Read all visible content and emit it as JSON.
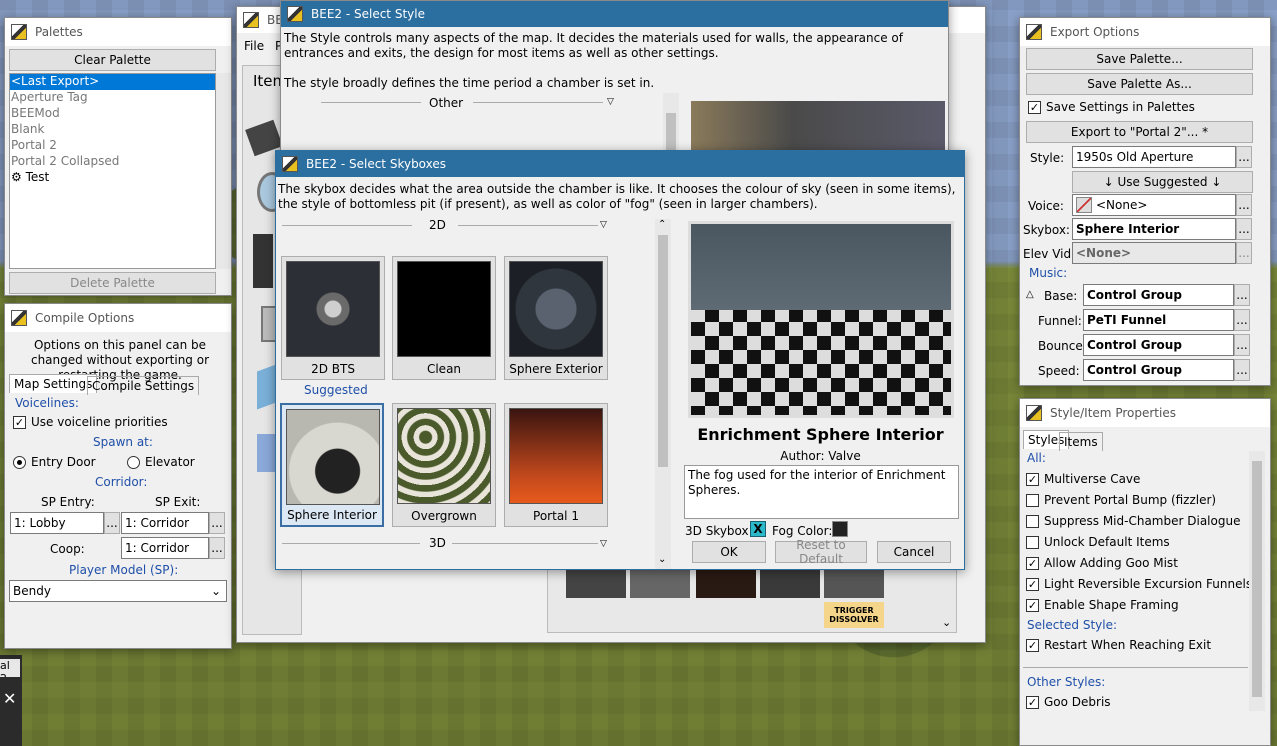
{
  "palettes": {
    "title": "Palettes",
    "clear": "Clear Palette",
    "delete": "Delete Palette",
    "items": [
      "<Last Export>",
      "Aperture Tag",
      "BEEMod",
      "Blank",
      "Portal 2",
      "Portal 2 Collapsed",
      "Test"
    ],
    "test_icon": "⚙"
  },
  "compile": {
    "title": "Compile Options",
    "desc": "Options on this panel can be changed without exporting or restarting the game.",
    "tab_map": "Map Settings",
    "tab_compile": "Compile Settings",
    "voicelines": "Voicelines:",
    "use_voice": "Use voiceline priorities",
    "spawn_at": "Spawn at:",
    "entry_door": "Entry Door",
    "elevator": "Elevator",
    "corridor": "Corridor:",
    "sp_entry": "SP Entry:",
    "sp_exit": "SP Exit:",
    "sp_entry_val": "1: Lobby",
    "sp_exit_val": "1: Corridor",
    "coop": "Coop:",
    "coop_val": "1: Corridor",
    "player_model": "Player Model (SP):",
    "player_model_val": "Bendy",
    "dots": "..."
  },
  "main": {
    "title": "BEE",
    "menu_file": "File",
    "menu_p": "P",
    "items_tab": "Item"
  },
  "style_win": {
    "title": "BEE2 - Select Style",
    "desc": "The Style controls many aspects of the map. It decides the materials used for walls, the appearance of entrances and exits, the design for most items as well as other settings.",
    "desc2": "The style broadly defines the time period a chamber is set in.",
    "group": "Other"
  },
  "sky_win": {
    "title": "BEE2 - Select Skyboxes",
    "desc": "The skybox decides what the area outside the chamber is like. It chooses the colour of sky (seen in some items), the style of bottomless pit (if present), as well as color of \"fog\" (seen in larger chambers).",
    "group_2d": "2D",
    "group_3d": "3D",
    "suggested": "Suggested",
    "tiles_row1": [
      "2D BTS",
      "Clean",
      "Sphere Exterior"
    ],
    "tiles_row2": [
      "Sphere Interior",
      "Overgrown",
      "Portal 1"
    ],
    "preview_title": "Enrichment Sphere Interior",
    "author": "Author: Valve",
    "description": "The fog used for the interior of Enrichment Spheres.",
    "skybox3d": "3D Skybox:",
    "fog_color": "Fog Color:",
    "ok": "OK",
    "reset": "Reset to Default",
    "cancel": "Cancel",
    "fog_hex": "#222222"
  },
  "palette_tile_text": "TRIGGER DISSOLVER",
  "export": {
    "title": "Export Options",
    "save_palette": "Save Palette...",
    "save_as": "Save Palette As...",
    "save_settings": "Save Settings in Palettes",
    "export_to": "Export to \"Portal 2\"... *",
    "style": "Style:",
    "style_val": "1950s Old Aperture",
    "use_suggested": "↓ Use Suggested ↓",
    "voice": "Voice:",
    "voice_val": "<None>",
    "skybox": "Skybox:",
    "skybox_val": "Sphere Interior",
    "elev": "Elev Vid:",
    "elev_val": "<None>",
    "music": "Music:",
    "base": "Base:",
    "base_val": "Control Group",
    "funnel": "Funnel:",
    "funnel_val": "PeTI Funnel",
    "bounce": "Bounce:",
    "bounce_val": "Control Group",
    "speed": "Speed:",
    "speed_val": "Control Group",
    "dots": "..."
  },
  "props": {
    "title": "Style/Item Properties",
    "tab_styles": "Styles",
    "tab_items": "Items",
    "all": "All:",
    "all_opts": [
      {
        "l": "Multiverse Cave",
        "c": true
      },
      {
        "l": "Prevent Portal Bump (fizzler)",
        "c": false
      },
      {
        "l": "Suppress Mid-Chamber Dialogue",
        "c": false
      },
      {
        "l": "Unlock Default Items",
        "c": false
      },
      {
        "l": "Allow Adding Goo Mist",
        "c": true
      },
      {
        "l": "Light Reversible Excursion Funnels",
        "c": true
      },
      {
        "l": "Enable Shape Framing",
        "c": true
      }
    ],
    "selected": "Selected Style:",
    "restart": "Restart When Reaching Exit",
    "other": "Other Styles:",
    "goo": "Goo Debris"
  },
  "taskbar": {
    "label": "al 2",
    "close": "✕"
  }
}
